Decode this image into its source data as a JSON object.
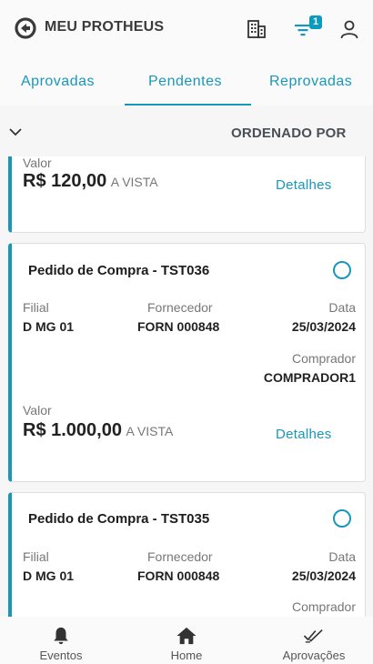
{
  "header": {
    "title": "MEU PROTHEUS",
    "filter_badge": "1"
  },
  "tabs": [
    {
      "label": "Aprovadas",
      "active": false
    },
    {
      "label": "Pendentes",
      "active": true
    },
    {
      "label": "Reprovadas",
      "active": false
    }
  ],
  "sort": {
    "label": "ORDENADO POR"
  },
  "cards": [
    {
      "value_label": "Valor",
      "amount": "R$ 120,00",
      "payment": "A VISTA",
      "details": "Detalhes"
    },
    {
      "title": "Pedido de Compra - TST036",
      "filial_label": "Filial",
      "filial": "D MG 01",
      "fornecedor_label": "Fornecedor",
      "fornecedor": "FORN 000848",
      "data_label": "Data",
      "data": "25/03/2024",
      "comprador_label": "Comprador",
      "comprador": "COMPRADOR1",
      "value_label": "Valor",
      "amount": "R$ 1.000,00",
      "payment": "A VISTA",
      "details": "Detalhes"
    },
    {
      "title": "Pedido de Compra - TST035",
      "filial_label": "Filial",
      "filial": "D MG 01",
      "fornecedor_label": "Fornecedor",
      "fornecedor": "FORN 000848",
      "data_label": "Data",
      "data": "25/03/2024",
      "comprador_label": "Comprador"
    }
  ],
  "bottom_nav": [
    {
      "label": "Eventos",
      "icon": "bell-icon"
    },
    {
      "label": "Home",
      "icon": "home-icon"
    },
    {
      "label": "Aprovações",
      "icon": "double-check-icon"
    }
  ],
  "colors": {
    "accent": "#1a97b8",
    "badge": "#0c9abe"
  }
}
